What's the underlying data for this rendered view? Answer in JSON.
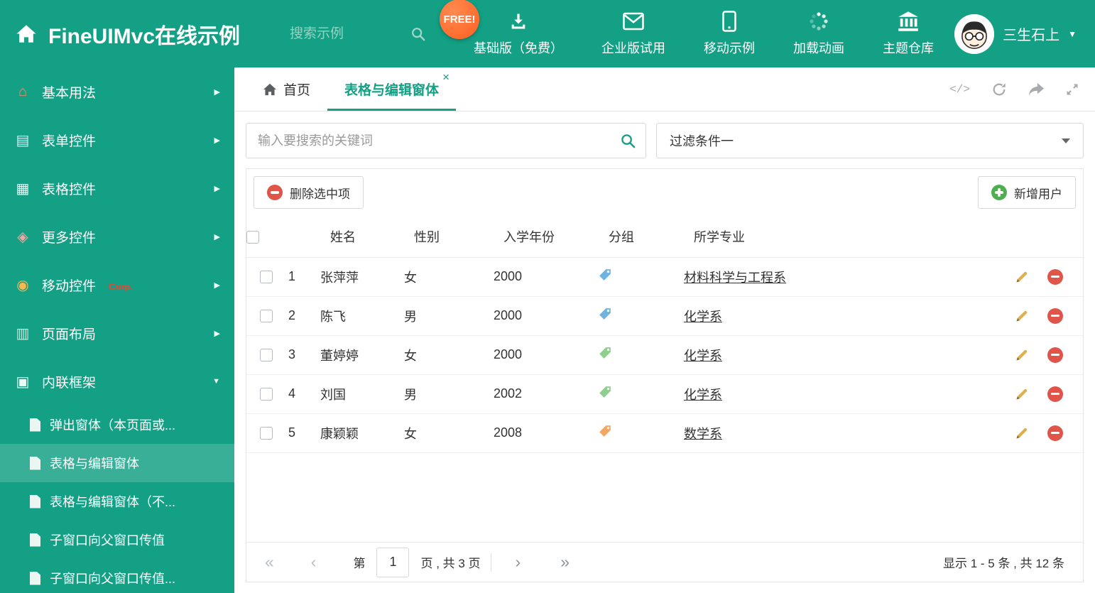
{
  "header": {
    "title": "FineUIMvc在线示例",
    "search_placeholder": "搜索示例",
    "free_badge": "FREE!",
    "nav": [
      {
        "label": "基础版（免费）",
        "icon": "download-icon"
      },
      {
        "label": "企业版试用",
        "icon": "envelope-icon"
      },
      {
        "label": "移动示例",
        "icon": "mobile-icon"
      },
      {
        "label": "加载动画",
        "icon": "spinner-icon"
      },
      {
        "label": "主题仓库",
        "icon": "bank-icon"
      }
    ],
    "user_name": "三生石上"
  },
  "sidebar": {
    "items": [
      {
        "label": "基本用法",
        "icon": "home-icon"
      },
      {
        "label": "表单控件",
        "icon": "form-icon"
      },
      {
        "label": "表格控件",
        "icon": "grid-icon"
      },
      {
        "label": "更多控件",
        "icon": "more-icon"
      },
      {
        "label": "移动控件",
        "tag": "Corp.",
        "icon": "signal-icon"
      },
      {
        "label": "页面布局",
        "icon": "layout-icon"
      },
      {
        "label": "内联框架",
        "icon": "frame-icon"
      }
    ],
    "subitems": [
      {
        "label": "弹出窗体（本页面或..."
      },
      {
        "label": "表格与编辑窗体"
      },
      {
        "label": "表格与编辑窗体（不..."
      },
      {
        "label": "子窗口向父窗口传值"
      },
      {
        "label": "子窗口向父窗口传值..."
      }
    ]
  },
  "tabs": {
    "home_label": "首页",
    "active_label": "表格与编辑窗体"
  },
  "filter": {
    "search_placeholder": "输入要搜索的关键词",
    "dropdown_value": "过滤条件一"
  },
  "toolbar": {
    "delete_label": "删除选中项",
    "add_label": "新增用户"
  },
  "table": {
    "headers": [
      "姓名",
      "性别",
      "入学年份",
      "分组",
      "所学专业"
    ],
    "rows": [
      {
        "num": "1",
        "name": "张萍萍",
        "gender": "女",
        "year": "2000",
        "tag_color": "#6fb3e0",
        "major": "材料科学与工程系"
      },
      {
        "num": "2",
        "name": "陈飞",
        "gender": "男",
        "year": "2000",
        "tag_color": "#6fb3e0",
        "major": "化学系"
      },
      {
        "num": "3",
        "name": "董婷婷",
        "gender": "女",
        "year": "2000",
        "tag_color": "#8ecf8e",
        "major": "化学系"
      },
      {
        "num": "4",
        "name": "刘国",
        "gender": "男",
        "year": "2002",
        "tag_color": "#8ecf8e",
        "major": "化学系"
      },
      {
        "num": "5",
        "name": "康颖颖",
        "gender": "女",
        "year": "2008",
        "tag_color": "#f2a862",
        "major": "数学系"
      }
    ]
  },
  "pagination": {
    "prefix": "第",
    "page": "1",
    "suffix": "页 , 共 3 页",
    "summary": "显示 1 - 5 条 , 共 12 条"
  },
  "colors": {
    "primary": "#14a085",
    "free_badge": "#ff5f1f",
    "delete_red": "#e0544a",
    "add_green": "#4fae50",
    "edit_yellow": "#deb04f"
  }
}
